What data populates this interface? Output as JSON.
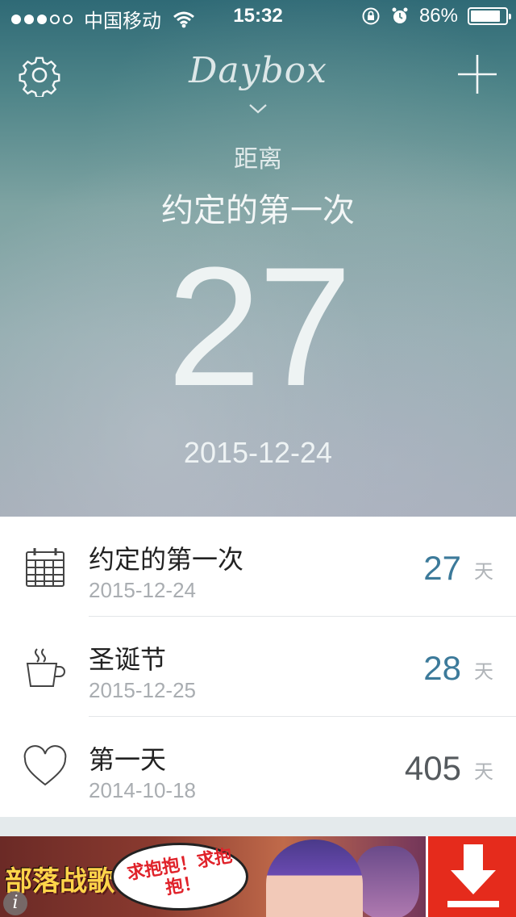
{
  "status_bar": {
    "carrier": "中国移动",
    "time": "15:32",
    "battery_percent": "86%",
    "battery_level": 0.86,
    "signal_bars_filled": 3,
    "signal_bars_total": 5
  },
  "header": {
    "app_name": "Daybox",
    "settings_icon": "gear-icon",
    "add_icon": "plus-icon",
    "expand_icon": "chevron-down-icon"
  },
  "hero": {
    "prefix": "距离",
    "event_title": "约定的第一次",
    "days": "27",
    "date": "2015-12-24"
  },
  "events": [
    {
      "icon": "calendar-icon",
      "title": "约定的第一次",
      "date": "2015-12-24",
      "count": "27",
      "unit": "天",
      "count_color": "#3c7a9a"
    },
    {
      "icon": "coffee-cup-icon",
      "title": "圣诞节",
      "date": "2015-12-25",
      "count": "28",
      "unit": "天",
      "count_color": "#3c7a9a"
    },
    {
      "icon": "heart-icon",
      "title": "第一天",
      "date": "2014-10-18",
      "count": "405",
      "unit": "天",
      "count_color": "#555a5e"
    }
  ],
  "ad": {
    "brand": "部落战歌",
    "bubble_text": "求抱抱！求抱抱！",
    "info_label": "i",
    "download_icon": "download-arrow-icon"
  }
}
